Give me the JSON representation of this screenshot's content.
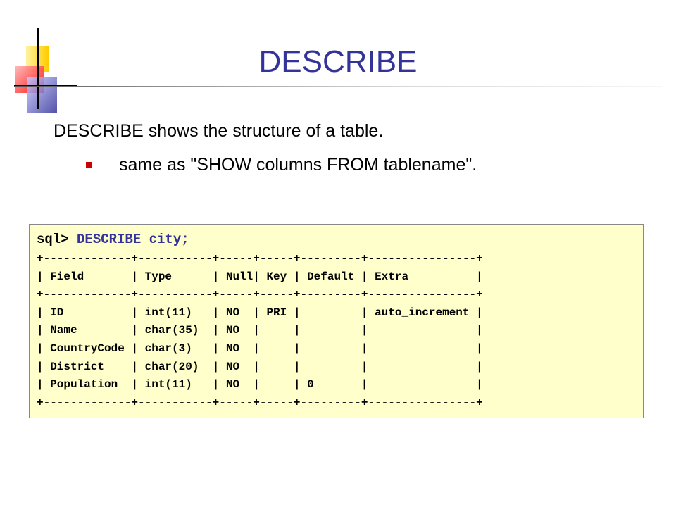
{
  "slide": {
    "title": "DESCRIBE",
    "body_text": "DESCRIBE shows the structure of a table.",
    "bullets": [
      {
        "text": "same as \"SHOW columns FROM tablename\"."
      }
    ]
  },
  "code": {
    "prompt": "sql> ",
    "command": "DESCRIBE city;",
    "lines": [
      "+-------------+-----------+-----+-----+---------+----------------+",
      "| Field       | Type      | Null| Key | Default | Extra          |",
      "+-------------+-----------+-----+-----+---------+----------------+",
      "| ID          | int(11)   | NO  | PRI |         | auto_increment |",
      "| Name        | char(35)  | NO  |     |         |                |",
      "| CountryCode | char(3)   | NO  |     |         |                |",
      "| District    | char(20)  | NO  |     |         |                |",
      "| Population  | int(11)   | NO  |     | 0       |                |",
      "+-------------+-----------+-----+-----+---------+----------------+"
    ]
  },
  "colors": {
    "title": "#333399",
    "bullet": "#cc0000",
    "code_background": "#ffffcc",
    "deco_yellow": "#ffcc00",
    "deco_red": "#ff0000",
    "deco_blue": "#333399"
  }
}
